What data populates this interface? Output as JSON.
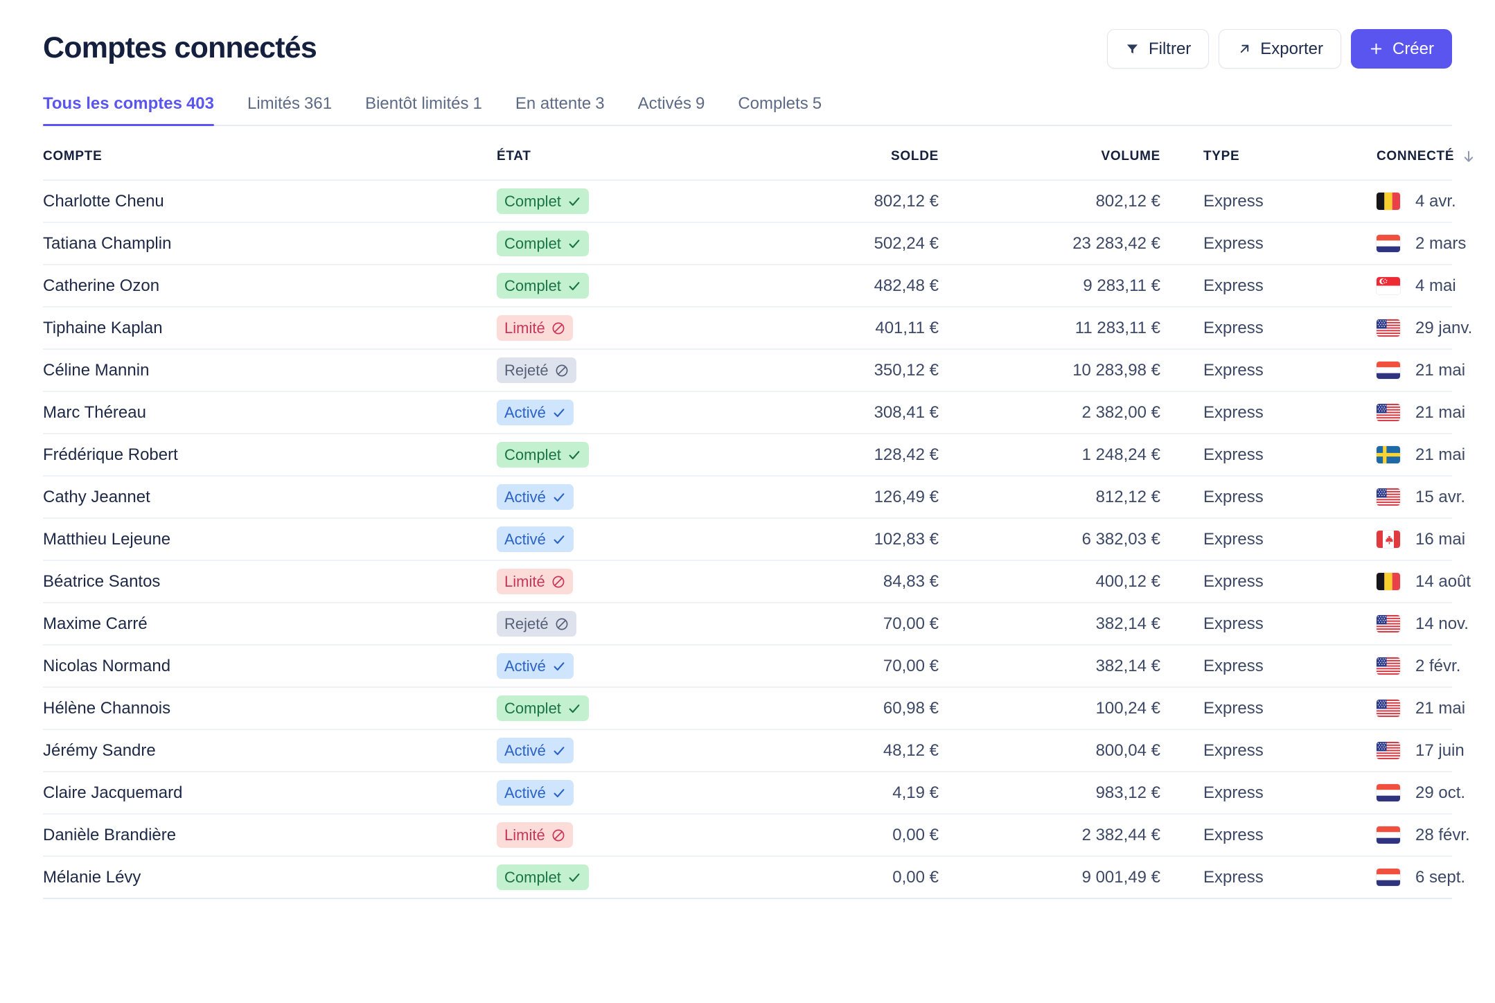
{
  "header": {
    "title": "Comptes connectés",
    "buttons": [
      {
        "label": "Filtrer",
        "icon": "filter-icon",
        "style": "ghost"
      },
      {
        "label": "Exporter",
        "icon": "arrow-up-right-icon",
        "style": "ghost"
      },
      {
        "label": "Créer",
        "icon": "plus-icon",
        "style": "primary"
      }
    ]
  },
  "tabs": [
    {
      "label": "Tous les comptes",
      "count": "403",
      "active": true
    },
    {
      "label": "Limités",
      "count": "361",
      "active": false
    },
    {
      "label": "Bientôt limités",
      "count": "1",
      "active": false
    },
    {
      "label": "En attente",
      "count": "3",
      "active": false
    },
    {
      "label": "Activés",
      "count": "9",
      "active": false
    },
    {
      "label": "Complets",
      "count": "5",
      "active": false
    }
  ],
  "table": {
    "columns": [
      {
        "key": "compte",
        "label": "COMPTE"
      },
      {
        "key": "etat",
        "label": "ÉTAT"
      },
      {
        "key": "solde",
        "label": "SOLDE"
      },
      {
        "key": "volume",
        "label": "VOLUME"
      },
      {
        "key": "type",
        "label": "TYPE"
      },
      {
        "key": "connecte",
        "label": "CONNECTÉ"
      }
    ],
    "sort": {
      "column": "CONNECTÉ",
      "direction": "desc",
      "icon": "arrow-down-icon"
    },
    "rows": [
      {
        "compte": "Charlotte Chenu",
        "etat": "Complet",
        "etat_kind": "complet",
        "solde": "802,12 €",
        "volume": "802,12 €",
        "type": "Express",
        "flag": "be",
        "date": "4 avr."
      },
      {
        "compte": "Tatiana Champlin",
        "etat": "Complet",
        "etat_kind": "complet",
        "solde": "502,24 €",
        "volume": "23 283,42 €",
        "type": "Express",
        "flag": "nl",
        "date": "2 mars"
      },
      {
        "compte": "Catherine Ozon",
        "etat": "Complet",
        "etat_kind": "complet",
        "solde": "482,48 €",
        "volume": "9 283,11 €",
        "type": "Express",
        "flag": "sg",
        "date": "4 mai"
      },
      {
        "compte": "Tiphaine Kaplan",
        "etat": "Limité",
        "etat_kind": "limite",
        "solde": "401,11 €",
        "volume": "11 283,11 €",
        "type": "Express",
        "flag": "us",
        "date": "29 janv."
      },
      {
        "compte": "Céline Mannin",
        "etat": "Rejeté",
        "etat_kind": "rejete",
        "solde": "350,12 €",
        "volume": "10 283,98 €",
        "type": "Express",
        "flag": "nl",
        "date": "21 mai"
      },
      {
        "compte": "Marc Théreau",
        "etat": "Activé",
        "etat_kind": "active",
        "solde": "308,41 €",
        "volume": "2 382,00 €",
        "type": "Express",
        "flag": "us",
        "date": "21 mai"
      },
      {
        "compte": "Frédérique Robert",
        "etat": "Complet",
        "etat_kind": "complet",
        "solde": "128,42 €",
        "volume": "1 248,24 €",
        "type": "Express",
        "flag": "se",
        "date": "21 mai"
      },
      {
        "compte": "Cathy Jeannet",
        "etat": "Activé",
        "etat_kind": "active",
        "solde": "126,49 €",
        "volume": "812,12 €",
        "type": "Express",
        "flag": "us",
        "date": "15 avr."
      },
      {
        "compte": "Matthieu Lejeune",
        "etat": "Activé",
        "etat_kind": "active",
        "solde": "102,83 €",
        "volume": "6 382,03 €",
        "type": "Express",
        "flag": "ca",
        "date": "16 mai"
      },
      {
        "compte": "Béatrice Santos",
        "etat": "Limité",
        "etat_kind": "limite",
        "solde": "84,83 €",
        "volume": "400,12 €",
        "type": "Express",
        "flag": "be",
        "date": "14 août"
      },
      {
        "compte": "Maxime Carré",
        "etat": "Rejeté",
        "etat_kind": "rejete",
        "solde": "70,00 €",
        "volume": "382,14 €",
        "type": "Express",
        "flag": "us",
        "date": "14 nov."
      },
      {
        "compte": "Nicolas Normand",
        "etat": "Activé",
        "etat_kind": "active",
        "solde": "70,00 €",
        "volume": "382,14 €",
        "type": "Express",
        "flag": "us",
        "date": "2 févr."
      },
      {
        "compte": "Hélène Channois",
        "etat": "Complet",
        "etat_kind": "complet",
        "solde": "60,98 €",
        "volume": "100,24 €",
        "type": "Express",
        "flag": "us",
        "date": "21 mai"
      },
      {
        "compte": "Jérémy Sandre",
        "etat": "Activé",
        "etat_kind": "active",
        "solde": "48,12 €",
        "volume": "800,04 €",
        "type": "Express",
        "flag": "us",
        "date": "17 juin"
      },
      {
        "compte": "Claire Jacquemard",
        "etat": "Activé",
        "etat_kind": "active",
        "solde": "4,19 €",
        "volume": "983,12 €",
        "type": "Express",
        "flag": "nl",
        "date": "29 oct."
      },
      {
        "compte": "Danièle Brandière",
        "etat": "Limité",
        "etat_kind": "limite",
        "solde": "0,00 €",
        "volume": "2 382,44 €",
        "type": "Express",
        "flag": "nl",
        "date": "28 févr."
      },
      {
        "compte": "Mélanie Lévy",
        "etat": "Complet",
        "etat_kind": "complet",
        "solde": "0,00 €",
        "volume": "9 001,49 €",
        "type": "Express",
        "flag": "nl",
        "date": "6 sept."
      }
    ]
  },
  "badge_icons": {
    "complet": "check-icon",
    "active": "check-icon",
    "limite": "blocked-icon",
    "rejete": "blocked-icon"
  },
  "colors": {
    "accent": "#5b55f0",
    "title": "#15203f",
    "complet_bg": "#c3f1d0",
    "complet_fg": "#197346",
    "limite_bg": "#fcdcd9",
    "limite_fg": "#c8365a",
    "rejete_bg": "#dde2ec",
    "rejete_fg": "#566179",
    "active_bg": "#cfe4fd",
    "active_fg": "#2a62c8"
  }
}
